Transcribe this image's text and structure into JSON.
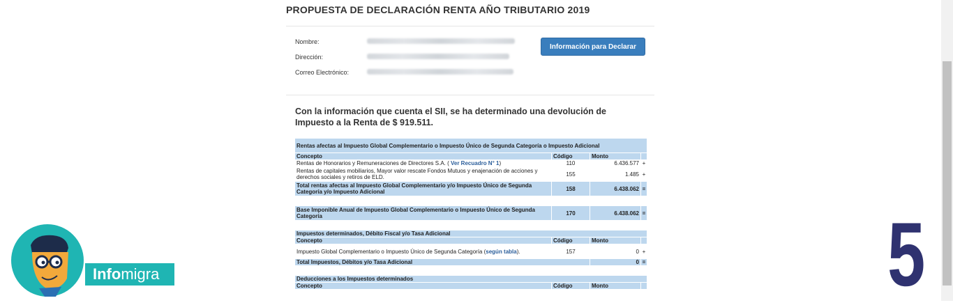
{
  "page": {
    "title": "PROPUESTA DE DECLARACIÓN RENTA AÑO TRIBUTARIO 2019"
  },
  "contributor": {
    "name_label": "Nombre:",
    "address_label": "Dirección:",
    "email_label": "Correo Electrónico:"
  },
  "buttons": {
    "info_declarar": "Información para Declarar"
  },
  "summary": "Con la información que cuenta el SII, se ha determinado una devolución de Impuesto a la Renta de $ 919.511.",
  "table": {
    "sec1_title": "Rentas afectas al Impuesto Global Complementario o Impuesto Único de Segunda Categoría o Impuesto Adicional",
    "col_concepto": "Concepto",
    "col_codigo": "Código",
    "col_monto": "Monto",
    "r1_concepto": "Rentas de Honorarios y Remuneraciones de Directores S.A. (",
    "r1_link": "Ver Recuadro N° 1",
    "r1_close": ")",
    "r1_codigo": "110",
    "r1_monto": "6.436.577",
    "r1_sign": "+",
    "r2_concepto": "Rentas de capitales mobiliarios, Mayor valor rescate Fondos Mutuos y enajenación de acciones y derechos sociales y retiros de ELD.",
    "r2_codigo": "155",
    "r2_monto": "1.485",
    "r2_sign": "+",
    "t1_concepto": "Total rentas afectas al Impuesto Global Complementario y/o Impuesto Único de Segunda Categoría y/o Impuesto Adicional",
    "t1_codigo": "158",
    "t1_monto": "6.438.062",
    "t1_sign": "=",
    "b1_concepto": "Base Imponible Anual de Impuesto Global Complementario o Impuesto Único de Segunda Categoría",
    "b1_codigo": "170",
    "b1_monto": "6.438.062",
    "b1_sign": "=",
    "sec2_title": "Impuestos determinados, Débito Fiscal y/o Tasa Adicional",
    "r3_concepto": "Impuesto Global Complementario o Impuesto Único de Segunda Categoría (",
    "r3_link": "según tabla",
    "r3_close": ").",
    "r3_codigo": "157",
    "r3_monto": "0",
    "r3_sign": "+",
    "t2_concepto": "Total Impuestos, Débitos y/o Tasa Adicional",
    "t2_monto": "0",
    "t2_sign": "=",
    "sec3_title": "Deducciones a los Impuestos determinados"
  },
  "watermark": {
    "logo_bold": "Info",
    "logo_light": "migra",
    "step_number": "5"
  }
}
